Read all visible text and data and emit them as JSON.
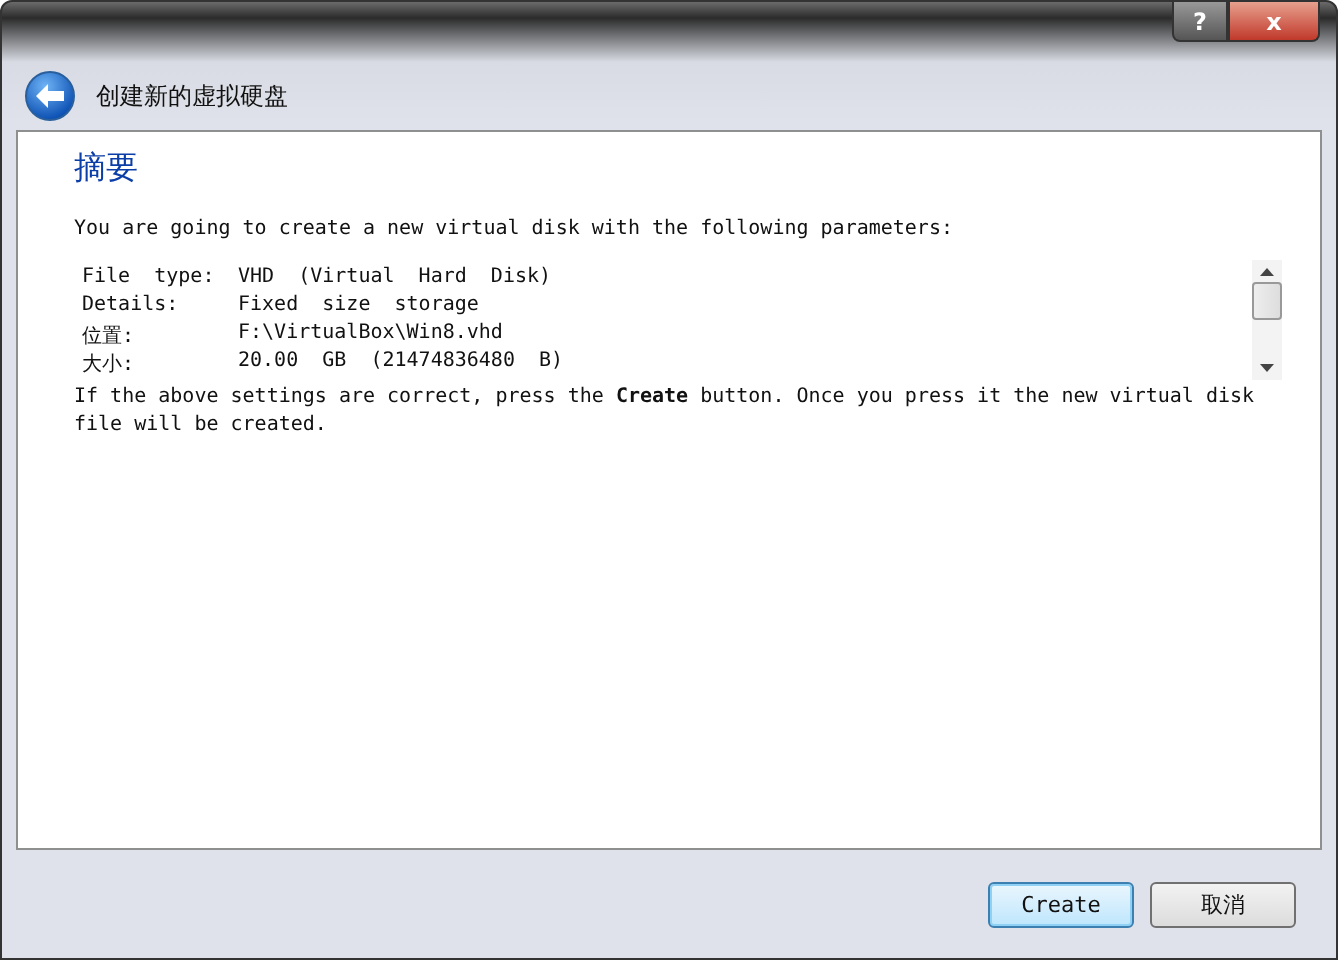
{
  "window": {
    "title": "创建新的虚拟硬盘",
    "caption_buttons": [
      {
        "kind": "help",
        "label": "?"
      },
      {
        "kind": "close",
        "label": "x"
      }
    ]
  },
  "page": {
    "heading": "摘要",
    "intro": "You are going to create a new virtual disk with the following parameters:",
    "parameters": [
      {
        "label": "File  type:",
        "value": "VHD  (Virtual  Hard  Disk)"
      },
      {
        "label": "Details:",
        "value": "Fixed  size  storage"
      },
      {
        "label": "位置:",
        "value": "F:\\VirtualBox\\Win8.vhd"
      },
      {
        "label": "大小:",
        "value": "20.00  GB  (21474836480  B)"
      }
    ],
    "note": "If the above settings are correct, press the **Create** button. Once you press it the new virtual disk file will be created."
  },
  "buttons": [
    {
      "label": "Create",
      "default": true
    },
    {
      "label": "取消",
      "default": false
    }
  ]
}
